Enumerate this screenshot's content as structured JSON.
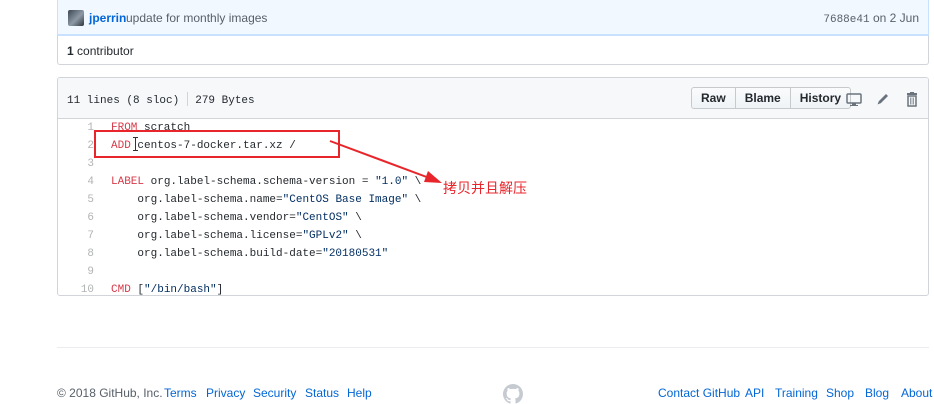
{
  "commit": {
    "author": "jperrin",
    "message": "update for monthly images",
    "sha": "7688e41",
    "date_prefix": "on",
    "date": "2 Jun"
  },
  "contributors": {
    "count": "1",
    "label": "contributor"
  },
  "file": {
    "lines": "11 lines (8 sloc)",
    "size": "279 Bytes",
    "buttons": {
      "raw": "Raw",
      "blame": "Blame",
      "history": "History"
    },
    "icons": [
      "desktop-icon",
      "pencil-icon",
      "trashcan-icon"
    ],
    "code": [
      {
        "n": "1",
        "kw": "FROM",
        "rest": " scratch"
      },
      {
        "n": "2",
        "kw": "ADD",
        "rest": " centos-7-docker.tar.xz /"
      },
      {
        "n": "3",
        "kw": "",
        "rest": ""
      },
      {
        "n": "4",
        "kw": "LABEL",
        "rest": " org.label-schema.schema-version = ",
        "str": "\"1.0\"",
        "tail": " \\"
      },
      {
        "n": "5",
        "kw": "",
        "rest": "    org.label-schema.name=",
        "str": "\"CentOS Base Image\"",
        "tail": " \\"
      },
      {
        "n": "6",
        "kw": "",
        "rest": "    org.label-schema.vendor=",
        "str": "\"CentOS\"",
        "tail": " \\"
      },
      {
        "n": "7",
        "kw": "",
        "rest": "    org.label-schema.license=",
        "str": "\"GPLv2\"",
        "tail": " \\"
      },
      {
        "n": "8",
        "kw": "",
        "rest": "    org.label-schema.build-date=",
        "str": "\"20180531\"",
        "tail": ""
      },
      {
        "n": "9",
        "kw": "",
        "rest": ""
      },
      {
        "n": "10",
        "kw": "CMD",
        "rest": " [",
        "str": "\"/bin/bash\"",
        "tail": "]"
      }
    ]
  },
  "annotation": {
    "text": "拷贝并且解压",
    "color": "#e8252b"
  },
  "footer": {
    "copyright": "© 2018 GitHub, Inc.",
    "left_links": [
      "Terms",
      "Privacy",
      "Security",
      "Status",
      "Help"
    ],
    "right_links": [
      "Contact GitHub",
      "API",
      "Training",
      "Shop",
      "Blog",
      "About"
    ]
  },
  "colors": {
    "link": "#0366d6",
    "keyword": "#d73a49",
    "string": "#032f62",
    "annotation": "#e8252b"
  }
}
